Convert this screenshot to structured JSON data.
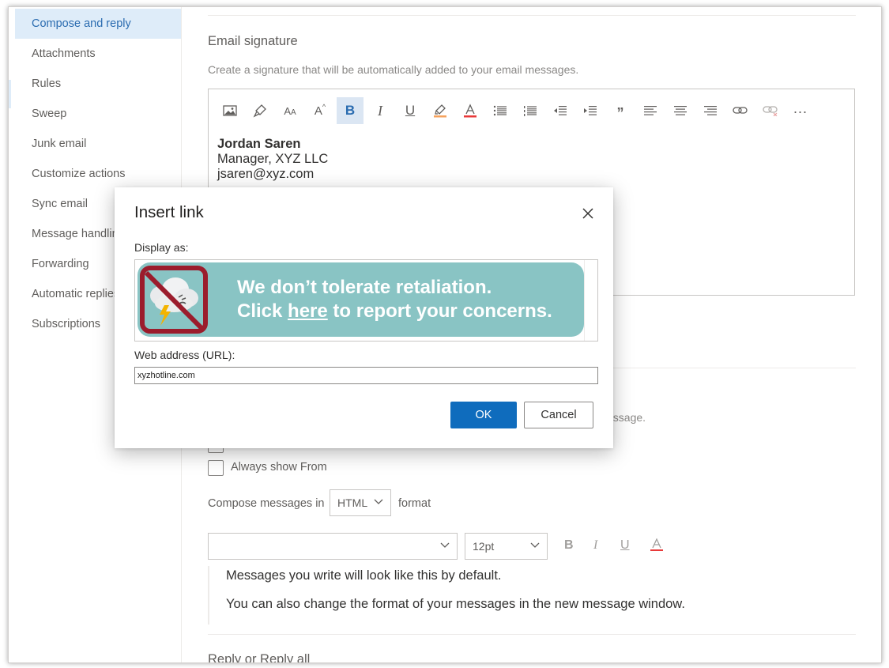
{
  "sidebar": {
    "items": [
      {
        "label": "Compose and reply",
        "active": true
      },
      {
        "label": "Attachments"
      },
      {
        "label": "Rules"
      },
      {
        "label": "Sweep"
      },
      {
        "label": "Junk email"
      },
      {
        "label": "Customize actions"
      },
      {
        "label": "Sync email"
      },
      {
        "label": "Message handling"
      },
      {
        "label": "Forwarding"
      },
      {
        "label": "Automatic replies"
      },
      {
        "label": "Subscriptions"
      }
    ]
  },
  "signature": {
    "title": "Email signature",
    "description": "Create a signature that will be automatically added to your email messages.",
    "toolbar_icons": [
      "image-icon",
      "format-painter-icon",
      "font-size-icon",
      "grow-font-icon",
      "bold-icon",
      "italic-icon",
      "underline-icon",
      "highlight-icon",
      "font-color-icon",
      "bullets-icon",
      "numbering-icon",
      "decrease-indent-icon",
      "increase-indent-icon",
      "quote-icon",
      "align-left-icon",
      "align-center-icon",
      "align-right-icon",
      "insert-link-icon",
      "remove-link-icon",
      "more-icon"
    ],
    "name": "Jordan Saren",
    "role": "Manager, XYZ LLC",
    "email": "jsaren@xyz.com"
  },
  "message_format": {
    "partial_desc": "essage.",
    "always_show_from": "Always show From",
    "compose_prefix": "Compose messages in",
    "compose_format": "HTML",
    "compose_suffix": "format",
    "font_size": "12pt",
    "preview_line1": "Messages you write will look like this by default.",
    "preview_line2": "You can also change the format of your messages in the new message window."
  },
  "next_section_title": "Reply or Reply all",
  "dialog": {
    "title": "Insert link",
    "display_label": "Display as:",
    "banner_line1": "We don’t tolerate retaliation.",
    "banner_line2_pre": "Click ",
    "banner_line2_link": "here",
    "banner_line2_post": " to report your concerns.",
    "url_label": "Web address (URL):",
    "url_value": "xyzhotline.com",
    "ok_label": "OK",
    "cancel_label": "Cancel"
  },
  "colors": {
    "accent": "#0f6cbd",
    "nav_active_bg": "#deecf9",
    "banner_bg": "#89c4c4",
    "prohibition_red": "#9b1c2c"
  }
}
